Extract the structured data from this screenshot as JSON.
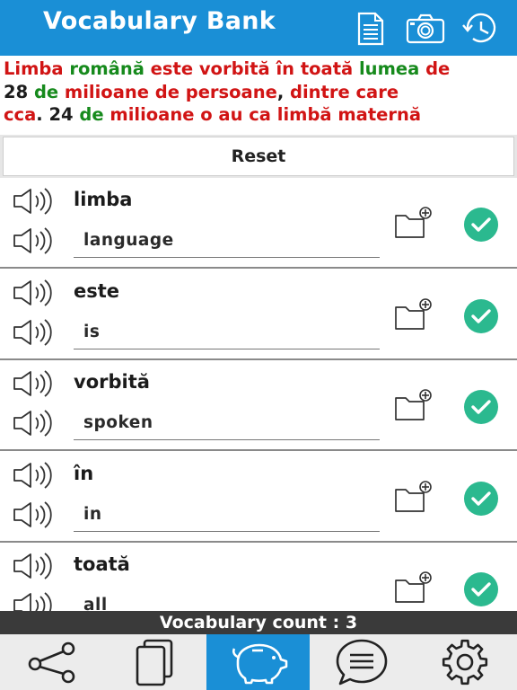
{
  "header": {
    "title": "Vocabulary Bank",
    "icons": [
      "document-icon",
      "camera-icon",
      "history-icon"
    ]
  },
  "sentence": {
    "segments": [
      {
        "text": "Limba ",
        "color": "red"
      },
      {
        "text": "română ",
        "color": "green"
      },
      {
        "text": "este ",
        "color": "red"
      },
      {
        "text": "vorbită ",
        "color": "red"
      },
      {
        "text": "în ",
        "color": "red"
      },
      {
        "text": "toată ",
        "color": "red"
      },
      {
        "text": "lumea ",
        "color": "green"
      },
      {
        "text": "de",
        "color": "red"
      },
      {
        "text": "28 ",
        "color": "dark"
      },
      {
        "text": "de ",
        "color": "green"
      },
      {
        "text": "milioane ",
        "color": "red"
      },
      {
        "text": "de ",
        "color": "red"
      },
      {
        "text": "persoane",
        "color": "red"
      },
      {
        "text": ", ",
        "color": "dark"
      },
      {
        "text": "dintre ",
        "color": "red"
      },
      {
        "text": "care",
        "color": "red"
      },
      {
        "text": "cca",
        "color": "red"
      },
      {
        "text": ". 24 ",
        "color": "dark"
      },
      {
        "text": "de ",
        "color": "green"
      },
      {
        "text": "milioane ",
        "color": "red"
      },
      {
        "text": "o ",
        "color": "red"
      },
      {
        "text": "au ",
        "color": "red"
      },
      {
        "text": "ca ",
        "color": "red"
      },
      {
        "text": "limbă ",
        "color": "red"
      },
      {
        "text": "maternă",
        "color": "red"
      }
    ]
  },
  "reset_label": "Reset",
  "vocab": [
    {
      "word": "limba",
      "translation": "language"
    },
    {
      "word": "este",
      "translation": "is"
    },
    {
      "word": "vorbită",
      "translation": "spoken"
    },
    {
      "word": "în",
      "translation": "in"
    },
    {
      "word": "toată",
      "translation": "all"
    }
  ],
  "footer": {
    "count_label": "Vocabulary count : 3"
  },
  "tabs": [
    {
      "name": "share-icon",
      "active": false
    },
    {
      "name": "cards-icon",
      "active": false
    },
    {
      "name": "piggy-bank-icon",
      "active": true
    },
    {
      "name": "chat-icon",
      "active": false
    },
    {
      "name": "settings-icon",
      "active": false
    }
  ],
  "colors": {
    "header_bg": "#1a8fd6",
    "red": "#d11414",
    "green": "#168a1c",
    "check": "#2bb98f",
    "count_bar": "#3a3a3a"
  }
}
